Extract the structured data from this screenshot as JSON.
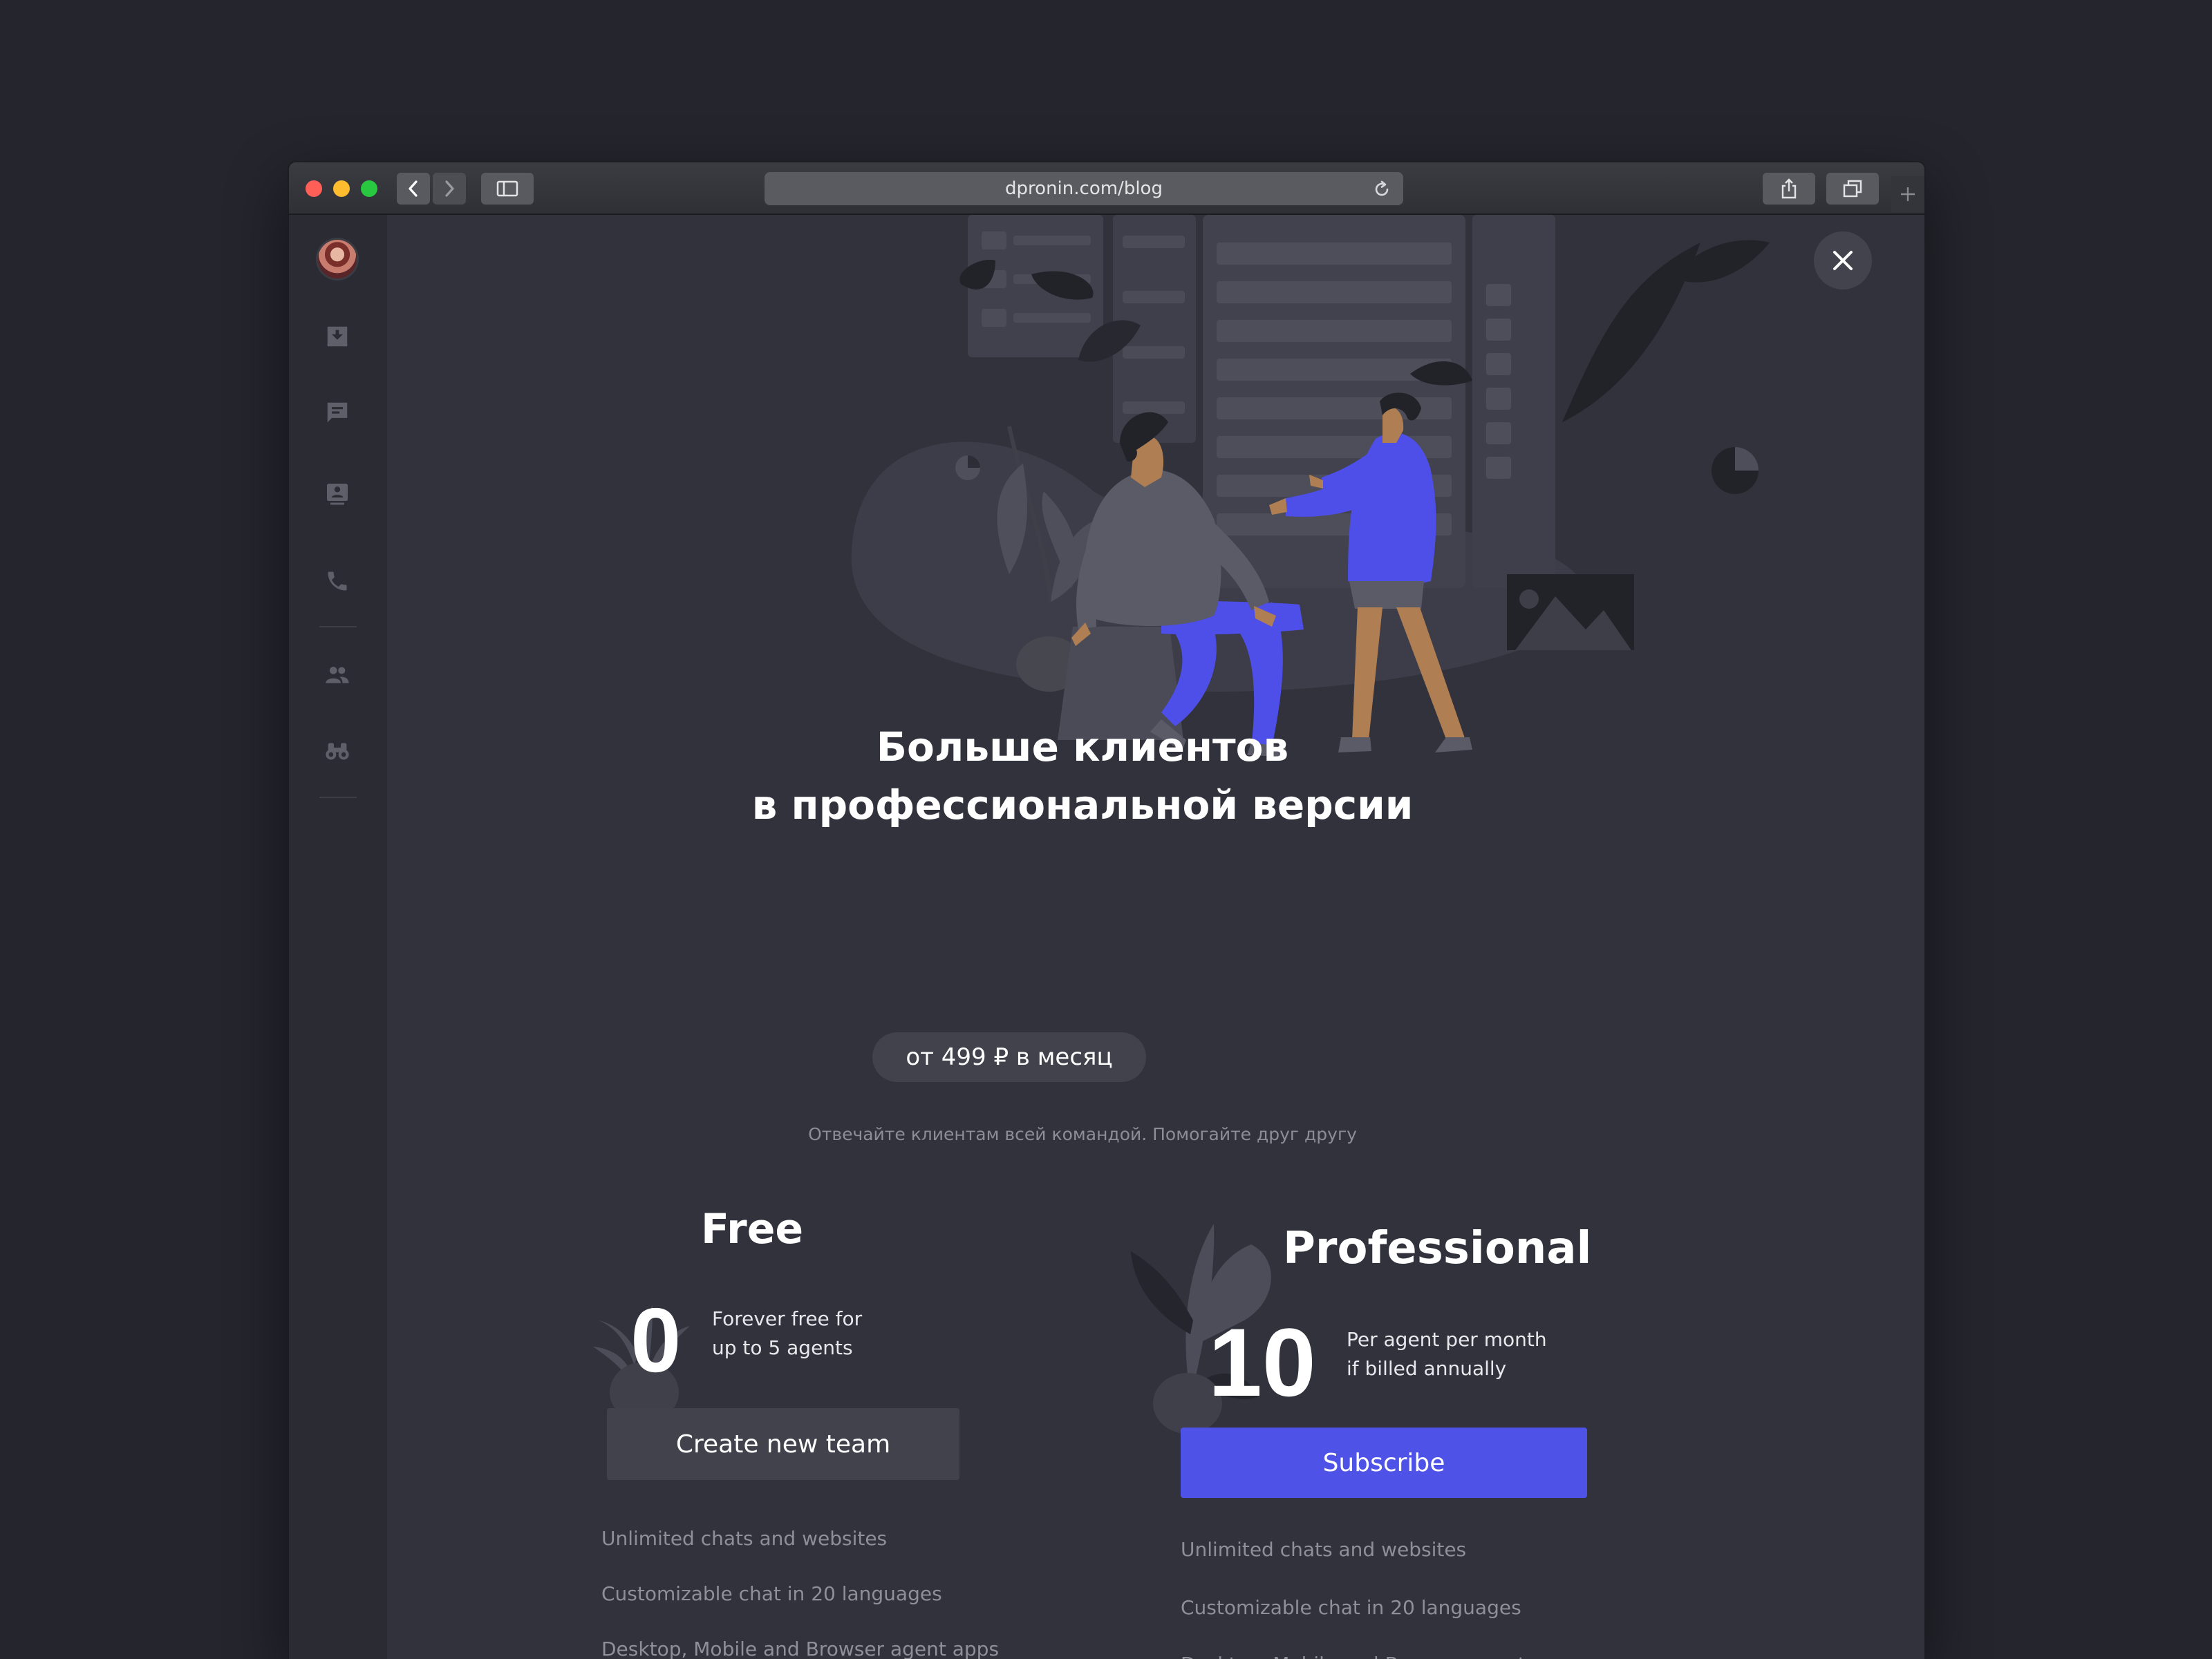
{
  "browser": {
    "url": "dpronin.com/blog"
  },
  "sidebar": {
    "items": [
      "avatar",
      "inbox-icon",
      "chat-icon",
      "contact-card-icon",
      "phone-icon",
      "team-icon",
      "binoculars-icon"
    ]
  },
  "hero": {
    "title_line1": "Больше клиентов",
    "title_line2": "в профессиональной версии",
    "price_pill": "от 499 ₽ в месяц",
    "subtitle": "Отвечайте клиентам всей командой. Помогайте друг другу"
  },
  "plans": {
    "free": {
      "name": "Free",
      "price": "0",
      "note_line1": "Forever free for",
      "note_line2": "up to 5 agents",
      "button": "Create new team",
      "features": [
        "Unlimited chats and websites",
        "Customizable chat in 20 languages",
        "Desktop, Mobile and Browser agent apps"
      ]
    },
    "professional": {
      "name": "Professional",
      "price": "10",
      "note_line1": "Per agent per month",
      "note_line2": "if billed annually",
      "button": "Subscribe",
      "features": [
        "Unlimited chats and websites",
        "Customizable chat in 20 languages",
        "Desktop, Mobile and Browser agent apps"
      ]
    }
  },
  "colors": {
    "accent": "#4f52e6",
    "background": "#31323c",
    "sidebar": "#2a2b33"
  }
}
